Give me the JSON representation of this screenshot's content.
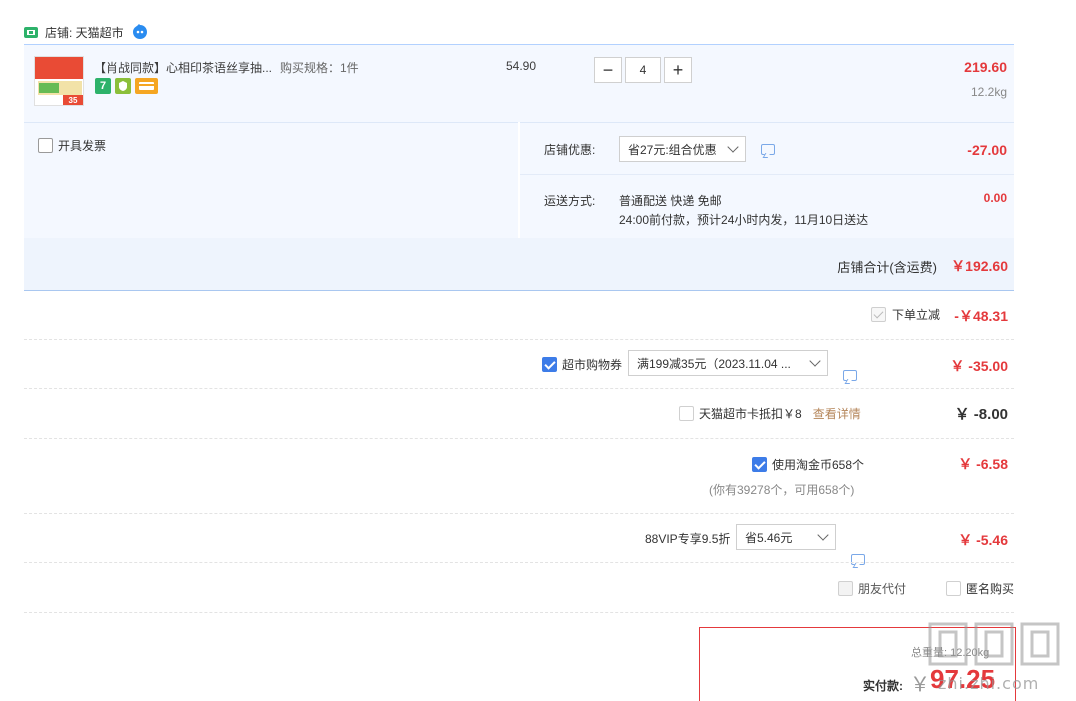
{
  "store": {
    "label": "店铺: 天猫超市"
  },
  "item": {
    "title": "【肖战同款】心相印茶语丝享抽...",
    "spec": "购买规格：1件",
    "badge_seven": "7",
    "price": "54.90",
    "qty_minus": "−",
    "qty": "4",
    "qty_plus": "+",
    "subtotal": "219.60",
    "weight": "12.2kg",
    "thumb_tag": "35"
  },
  "invoice": {
    "label": "开具发票"
  },
  "store_discount": {
    "label": "店铺优惠:",
    "selected": "省27元:组合优惠",
    "amount": "-27.00"
  },
  "shipping": {
    "label": "运送方式:",
    "method": "普通配送 快递 免邮",
    "eta": "24:00前付款，预计24小时内发，11月10日送达",
    "amount": "0.00"
  },
  "store_total": {
    "label": "店铺合计(含运费)",
    "amount": "￥192.60"
  },
  "instant_discount": {
    "label": "下单立减",
    "amount": "-￥48.31"
  },
  "supermarket_coupon": {
    "label": "超市购物券",
    "selected": "满199减35元（2023.11.04 ...",
    "amount": "￥ -35.00"
  },
  "card_deduct": {
    "label": "天猫超市卡抵扣￥8",
    "link": "查看详情",
    "amount": "￥ -8.00"
  },
  "taojinbi": {
    "label": "使用淘金币658个",
    "note": "(你有39278个，可用658个)",
    "amount": "￥ -6.58"
  },
  "vip": {
    "label": "88VIP专享9.5折",
    "selected": "省5.46元",
    "amount": "￥ -5.46"
  },
  "options": {
    "friend_pay": "朋友代付",
    "anonymous": "匿名购买"
  },
  "summary": {
    "total_weight": "总重量: 12.20kg",
    "pay_label": "实付款:",
    "currency": "￥",
    "pay_amount": "97.25"
  },
  "watermark": {
    "text": "zhi.zhi.com"
  },
  "colors": {
    "accent_red": "#e4393c",
    "accent_blue": "#3d7ce8",
    "row_bg": "#f4f8ff"
  }
}
